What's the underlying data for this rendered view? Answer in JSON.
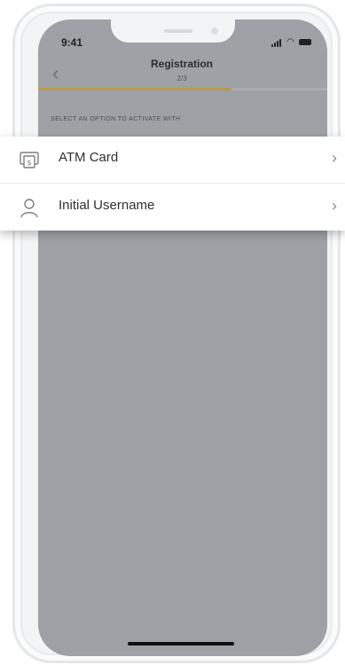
{
  "status_bar": {
    "time": "9:41"
  },
  "nav": {
    "title": "Registration",
    "step": "2/3",
    "progress_fraction": 0.67
  },
  "section": {
    "label": "SELECT AN OPTION TO ACTIVATE WITH"
  },
  "options": [
    {
      "label": "ATM Card",
      "icon": "atm-card-icon"
    },
    {
      "label": "Initial Username",
      "icon": "user-icon"
    }
  ],
  "colors": {
    "overlay": "#9ea1a5",
    "accent": "#b99a4a",
    "card": "#ffffff"
  }
}
